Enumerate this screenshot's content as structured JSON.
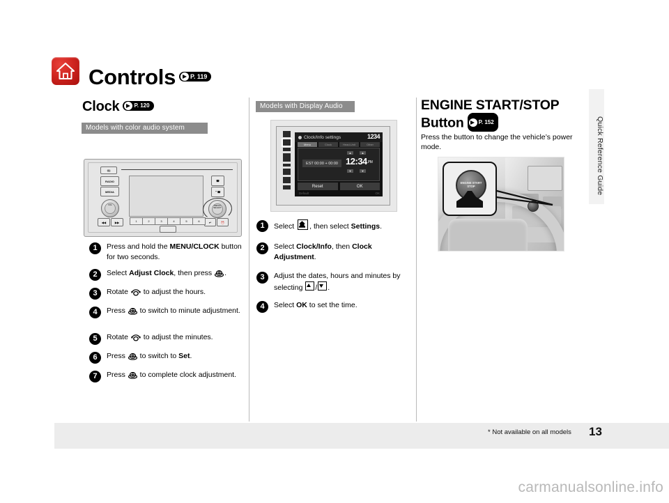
{
  "document": {
    "side_tab_label": "Quick Reference Guide",
    "page_number": "13",
    "footnote": "* Not available on all models",
    "watermark": "carmanualsonline.info",
    "home_icon": "home-icon"
  },
  "left_column": {
    "section_title": "Controls",
    "section_ref": "P. 119",
    "subsection_title": "Clock",
    "subsection_ref": "P. 120",
    "model_badge": "Models with color audio system",
    "illustration": {
      "name": "color-audio-system-faceplate",
      "buttons": [
        "RADIO",
        "MEDIA"
      ],
      "preset_numbers": [
        "1",
        "2",
        "3",
        "4",
        "5",
        "6"
      ],
      "knob_left_label": "VOL",
      "knob_right_label": "MENU/ SELECT",
      "icons": [
        "power-icon",
        "phone-icon",
        "track-back-icon",
        "track-forward-icon",
        "back-icon",
        "clock-icon"
      ]
    },
    "steps": [
      {
        "num": "1",
        "html": "Press and hold the <b>MENU/CLOCK</b> button for two seconds."
      },
      {
        "num": "2",
        "html": "Select <b>Adjust Clock</b>, then press <span class=\"g-knob\"></span>."
      },
      {
        "num": "3",
        "html": "Rotate <span class=\"g-dial\"></span> to adjust the hours."
      },
      {
        "num": "4",
        "html": "Press <span class=\"g-knob\"></span> to switch to minute adjustment."
      },
      {
        "num": "5",
        "html": "Rotate <span class=\"g-dial\"></span> to adjust the minutes."
      },
      {
        "num": "6",
        "html": "Press <span class=\"g-knob\"></span> to switch to <b>Set</b>."
      },
      {
        "num": "7",
        "html": "Press <span class=\"g-knob\"></span> to complete clock adjustment."
      }
    ]
  },
  "middle_column": {
    "model_badge": "Models with Display Audio",
    "illustration": {
      "name": "display-audio-clock-info-settings-screen",
      "screen_title": "Clock/Info settings",
      "clock_readout": "1234",
      "tabs": [
        "Menu",
        "Clock",
        "Head-Unit",
        "Other"
      ],
      "time_zone_field": "EST 00:00 + 00:00",
      "time_hours": "12",
      "time_separator": ":",
      "time_minutes": "34",
      "time_ampm": "PM",
      "soft_buttons": [
        "Reset",
        "OK"
      ],
      "ghost_labels": [
        "Default",
        "OK"
      ],
      "stepper_up": "▲",
      "stepper_down": "▼"
    },
    "steps": [
      {
        "num": "1",
        "html": "Select <span class=\"g-home\"></span>, then select <b>Settings</b>."
      },
      {
        "num": "2",
        "html": "Select <b>Clock/Info</b>, then <b>Clock Adjustment</b>."
      },
      {
        "num": "3",
        "html": "Adjust the dates, hours and minutes by selecting <span class=\"g-arrow-box up\"></span>/<span class=\"g-arrow-box down\"></span>."
      },
      {
        "num": "4",
        "html": "Select <b>OK</b> to set the time."
      }
    ]
  },
  "right_column": {
    "section_title": "ENGINE START/STOP Button",
    "section_ref": "P. 152",
    "description": "Press the button to change the vehicle’s power mode.",
    "illustration": {
      "name": "engine-start-stop-button-dashboard-photo",
      "callout_button_label": "ENGINE START STOP"
    }
  },
  "colors": {
    "home_icon_red": "#d02520",
    "badge_gray": "#8c8c8c",
    "footer_band": "#ececec",
    "rule": "#b9b9b9",
    "watermark": "#b9b9b9"
  }
}
